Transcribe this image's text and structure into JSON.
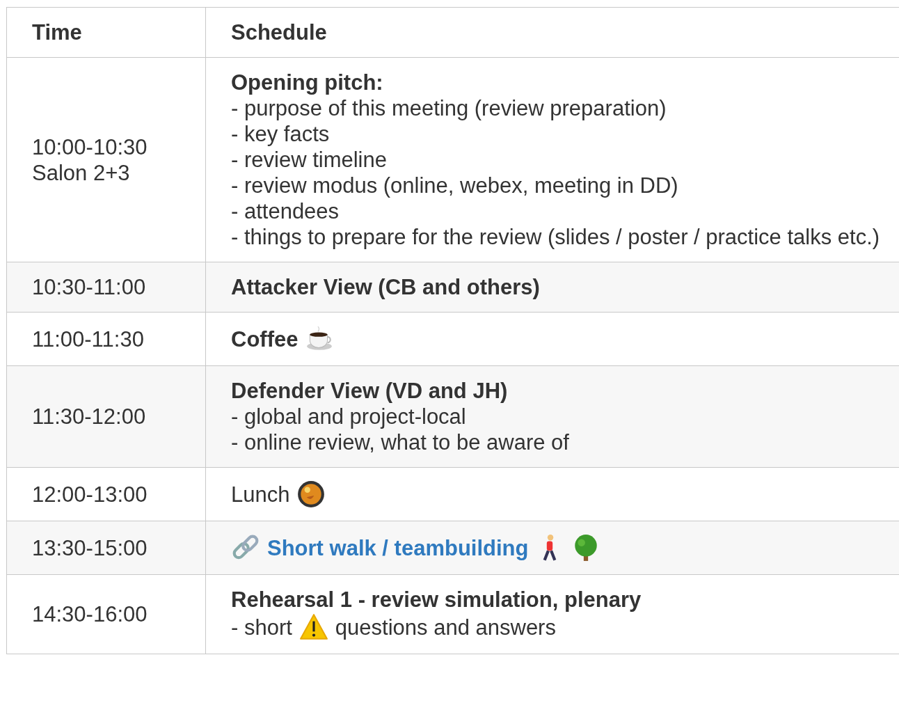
{
  "table": {
    "columns": [
      "Time",
      "Schedule"
    ],
    "rows": [
      {
        "time": [
          "10:00-10:30",
          "Salon 2+3"
        ],
        "lines": [
          [
            {
              "kind": "bold",
              "text": "Opening pitch:"
            }
          ],
          [
            {
              "kind": "text",
              "text": "- purpose of this meeting (review preparation)"
            }
          ],
          [
            {
              "kind": "text",
              "text": "- key facts"
            }
          ],
          [
            {
              "kind": "text",
              "text": "- review timeline"
            }
          ],
          [
            {
              "kind": "text",
              "text": "- review modus (online, webex, meeting in DD)"
            }
          ],
          [
            {
              "kind": "text",
              "text": "- attendees"
            }
          ],
          [
            {
              "kind": "text",
              "text": "- things to prepare for the review (slides / poster / practice talks etc.)"
            }
          ]
        ]
      },
      {
        "time": [
          "10:30-11:00"
        ],
        "lines": [
          [
            {
              "kind": "bold",
              "text": "Attacker View (CB and others)"
            }
          ]
        ]
      },
      {
        "time": [
          "11:00-11:30"
        ],
        "lines": [
          [
            {
              "kind": "bold",
              "text": "Coffee"
            },
            {
              "kind": "cup"
            }
          ]
        ]
      },
      {
        "time": [
          "11:30-12:00"
        ],
        "lines": [
          [
            {
              "kind": "bold",
              "text": "Defender View (VD and JH)"
            }
          ],
          [
            {
              "kind": "text",
              "text": "- global and project-local"
            }
          ],
          [
            {
              "kind": "text",
              "text": "- online review, what to be aware of"
            }
          ]
        ]
      },
      {
        "time": [
          "12:00-13:00"
        ],
        "lines": [
          [
            {
              "kind": "text",
              "text": "Lunch"
            },
            {
              "kind": "pan"
            }
          ]
        ]
      },
      {
        "time": [
          "13:30-15:00"
        ],
        "lines": [
          [
            {
              "kind": "chain"
            },
            {
              "kind": "link",
              "text": "Short walk / teambuilding"
            },
            {
              "kind": "walker"
            },
            {
              "kind": "tree"
            }
          ]
        ]
      },
      {
        "time": [
          "14:30-16:00"
        ],
        "lines": [
          [
            {
              "kind": "bold",
              "text": "Rehearsal 1 - review simulation, plenary"
            }
          ],
          [
            {
              "kind": "text",
              "text": "- short"
            },
            {
              "kind": "warning"
            },
            {
              "kind": "text",
              "text": "questions and answers"
            }
          ]
        ]
      }
    ]
  }
}
